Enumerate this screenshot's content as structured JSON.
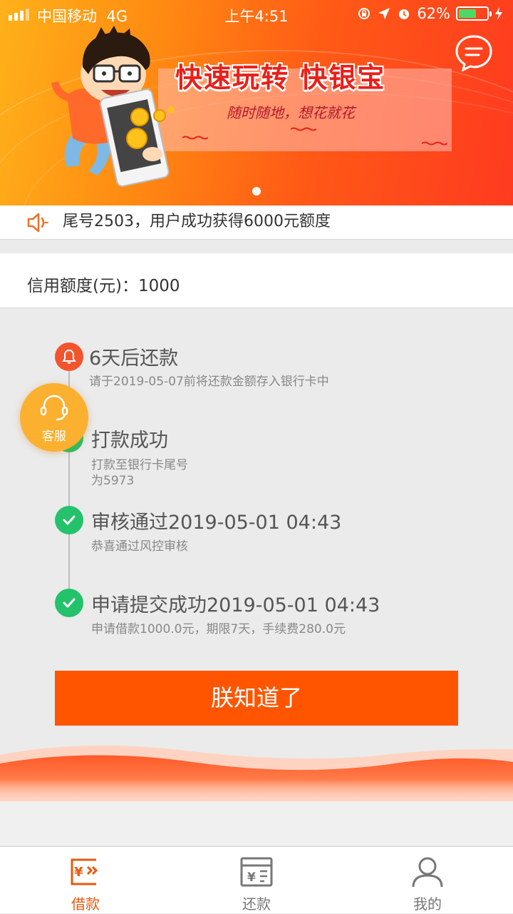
{
  "status_bar": {
    "carrier": "中国移动",
    "network": "4G",
    "time": "上午4:51",
    "battery": "62%",
    "battery_level": 0.62
  },
  "banner": {
    "title": "快速玩转 快银宝",
    "subtitle": "随时随地，想花就花"
  },
  "notice": {
    "text": "尾号2503，用户成功获得6000元额度"
  },
  "credit": {
    "text": "信用额度(元)：1000"
  },
  "timeline": [
    {
      "title": "6天后还款",
      "desc": "请于2019-05-07前将还款金额存入银行卡中",
      "icon": "bell-icon",
      "color": "#f2542d"
    },
    {
      "title": "打款成功",
      "desc": "打款至银行卡尾号",
      "desc2": "为5973",
      "icon": "check-icon",
      "color": "#23c26b"
    },
    {
      "title": "审核通过2019-05-01 04:43",
      "desc": "恭喜通过风控审核",
      "icon": "check-icon",
      "color": "#23c26b"
    },
    {
      "title": "申请提交成功2019-05-01 04:43",
      "desc": "申请借款1000.0元，期限7天，手续费280.0元",
      "icon": "check-icon",
      "color": "#23c26b"
    }
  ],
  "service": {
    "label": "客服"
  },
  "confirm_button": {
    "label": "朕知道了"
  },
  "tabs": [
    {
      "label": "借款",
      "icon": "loan-icon",
      "active": true
    },
    {
      "label": "还款",
      "icon": "repay-icon",
      "active": false
    },
    {
      "label": "我的",
      "icon": "user-icon",
      "active": false
    }
  ],
  "colors": {
    "accent": "#ff5500",
    "tab_active": "#e8590c",
    "tab_inactive": "#777777"
  }
}
